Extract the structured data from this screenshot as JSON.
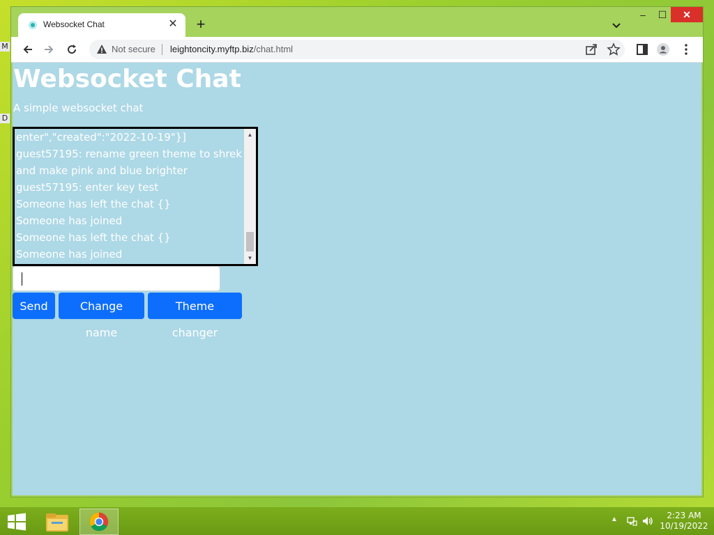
{
  "desktop": {
    "hint_top": "M",
    "hint_bottom": "D"
  },
  "browser": {
    "tab": {
      "title": "Websocket Chat",
      "close_glyph": "✕"
    },
    "new_tab_glyph": "+",
    "tab_search_glyph": "⌄",
    "window_controls": {
      "minimize": "–",
      "maximize": "☐",
      "close": "✕"
    },
    "toolbar": {
      "not_secure_label": "Not secure",
      "url_host": "leightoncity.myftp.biz",
      "url_path": "/chat.html"
    },
    "icons": [
      "back-arrow-icon",
      "forward-arrow-icon",
      "reload-icon",
      "warning-icon",
      "share-icon",
      "star-icon",
      "side-panel-icon",
      "profile-icon",
      "kebab-menu-icon"
    ]
  },
  "page": {
    "title": "Websocket Chat",
    "subtitle": "A simple websocket chat",
    "chat_messages": [
      "enter\",\"created\":\"2022-10-19\"}]",
      "guest57195: rename green theme to shrek",
      "and make pink and blue brighter",
      "guest57195: enter key test",
      "Someone has left the chat {}",
      "Someone has joined",
      "Someone has left the chat {}",
      "Someone has joined"
    ],
    "message_input_value": "",
    "buttons": {
      "send": "Send",
      "change_name": "Change name",
      "theme_changer": "Theme changer"
    },
    "colors": {
      "background": "#add8e6",
      "button": "#0d6efd",
      "text": "#ffffff"
    }
  },
  "taskbar": {
    "clock_time": "2:23 AM",
    "clock_date": "10/19/2022",
    "tray_arrow": "▲"
  }
}
